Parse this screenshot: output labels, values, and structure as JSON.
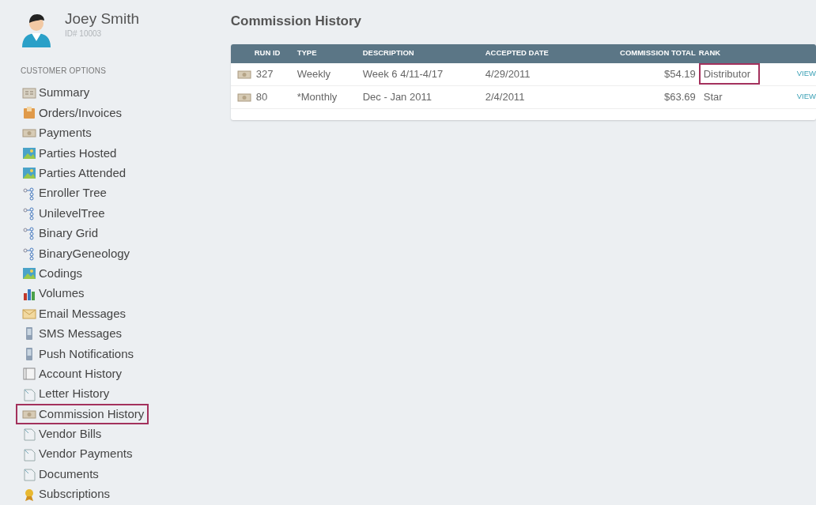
{
  "profile": {
    "name": "Joey Smith",
    "id": "ID# 10003"
  },
  "sidebar": {
    "heading": "CUSTOMER OPTIONS",
    "items": [
      {
        "label": "Summary",
        "kind": "grid",
        "selected": false
      },
      {
        "label": "Orders/Invoices",
        "kind": "box",
        "selected": false
      },
      {
        "label": "Payments",
        "kind": "money",
        "selected": false
      },
      {
        "label": "Parties Hosted",
        "kind": "photo",
        "selected": false
      },
      {
        "label": "Parties Attended",
        "kind": "photo",
        "selected": false
      },
      {
        "label": "Enroller Tree",
        "kind": "tree",
        "selected": false
      },
      {
        "label": "UnilevelTree",
        "kind": "tree",
        "selected": false
      },
      {
        "label": "Binary Grid",
        "kind": "tree",
        "selected": false
      },
      {
        "label": "BinaryGeneology",
        "kind": "tree",
        "selected": false
      },
      {
        "label": "Codings",
        "kind": "photo",
        "selected": false
      },
      {
        "label": "Volumes",
        "kind": "chart",
        "selected": false
      },
      {
        "label": "Email Messages",
        "kind": "mail",
        "selected": false
      },
      {
        "label": "SMS Messages",
        "kind": "phone",
        "selected": false
      },
      {
        "label": "Push Notifications",
        "kind": "phone",
        "selected": false
      },
      {
        "label": "Account History",
        "kind": "book",
        "selected": false
      },
      {
        "label": "Letter History",
        "kind": "doc",
        "selected": false
      },
      {
        "label": "Commission History",
        "kind": "money",
        "selected": true
      },
      {
        "label": "Vendor Bills",
        "kind": "doc",
        "selected": false
      },
      {
        "label": "Vendor Payments",
        "kind": "doc",
        "selected": false
      },
      {
        "label": "Documents",
        "kind": "doc",
        "selected": false
      },
      {
        "label": "Subscriptions",
        "kind": "medal",
        "selected": false
      }
    ]
  },
  "page": {
    "title": "Commission History"
  },
  "table": {
    "columns": [
      "RUN ID",
      "TYPE",
      "DESCRIPTION",
      "ACCEPTED DATE",
      "COMMISSION TOTAL",
      "RANK"
    ],
    "rows": [
      {
        "run_id": "327",
        "type": "Weekly",
        "description": "Week 6 4/11-4/17",
        "accepted_date": "4/29/2011",
        "commission_total": "$54.19",
        "rank": "Distributor",
        "rank_highlighted": true,
        "action": "VIEW"
      },
      {
        "run_id": "80",
        "type": "*Monthly",
        "description": "Dec - Jan 2011",
        "accepted_date": "2/4/2011",
        "commission_total": "$63.69",
        "rank": "Star",
        "rank_highlighted": false,
        "action": "VIEW"
      }
    ]
  }
}
